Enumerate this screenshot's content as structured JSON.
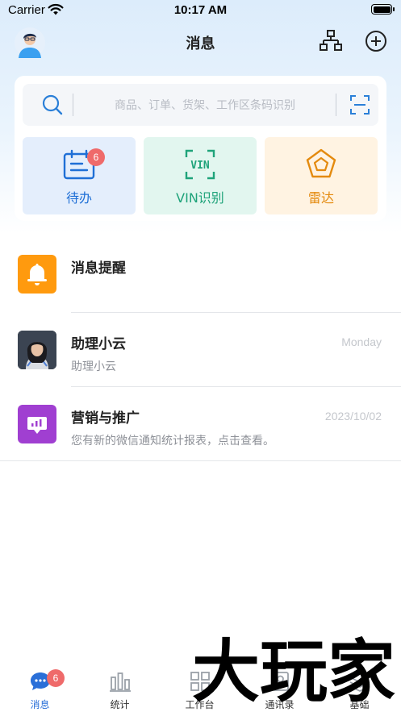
{
  "status_bar": {
    "carrier": "Carrier",
    "time": "10:17 AM"
  },
  "header": {
    "title": "消息"
  },
  "search": {
    "placeholder": "商品、订单、货架、工作区条码识别"
  },
  "quick_actions": [
    {
      "label": "待办",
      "badge": "6",
      "color": "#1f6fd6"
    },
    {
      "label": "VIN识别",
      "icon_text": "VIN",
      "color": "#1fa37a"
    },
    {
      "label": "雷达",
      "color": "#e48a0e"
    }
  ],
  "messages": [
    {
      "title": "消息提醒",
      "time": "",
      "preview": "",
      "icon": "bell-icon",
      "icon_color": "#ff9a0e"
    },
    {
      "title": "助理小云",
      "time": "Monday",
      "preview": "助理小云",
      "icon": "assistant-avatar"
    },
    {
      "title": "营销与推广",
      "time": "2023/10/02",
      "preview": "您有新的微信通知统计报表，点击查看。",
      "icon": "chart-board-icon",
      "icon_color": "#a03fd1"
    }
  ],
  "tab_bar": [
    {
      "label": "消息",
      "badge": "6",
      "active": true
    },
    {
      "label": "统计"
    },
    {
      "label": "工作台"
    },
    {
      "label": "通讯录"
    },
    {
      "label": "基础"
    }
  ],
  "watermark": {
    "text": "大玩家"
  },
  "colors": {
    "accent": "#2a6fd8",
    "badge": "#ef6a6a"
  }
}
